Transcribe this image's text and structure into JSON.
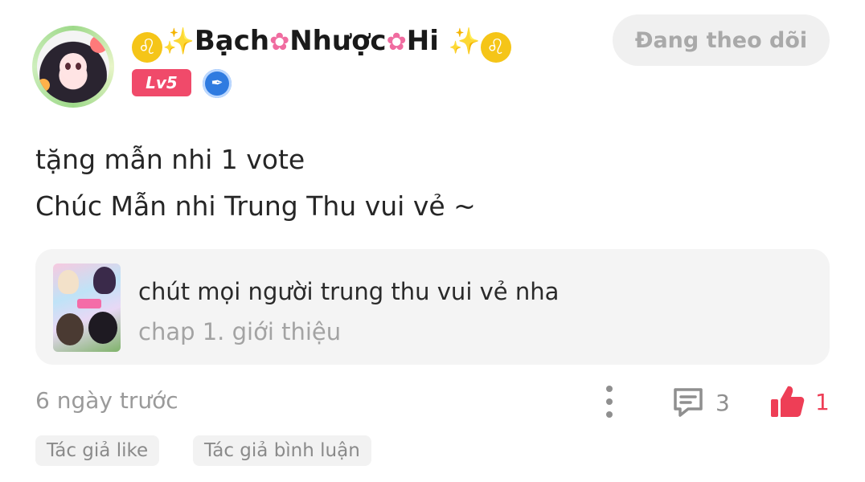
{
  "post": {
    "author": {
      "name_parts": [
        "Bạch",
        "Nhược",
        "Hi"
      ],
      "level": "Lv5",
      "avatar_icon": "anime-girl-avatar",
      "badge_icon": "pen-nib-icon"
    },
    "follow_label": "Đang theo dõi",
    "content_lines": [
      "tặng mẫn nhi 1 vote",
      "Chúc Mẫn nhi Trung Thu vui vẻ ~"
    ],
    "linked_card": {
      "title": "chút mọi người trung thu vui vẻ nha",
      "subtitle": "chap 1. giới thiệu",
      "thumbnail_icon": "comic-cover-thumbnail"
    },
    "timestamp": "6 ngày trước",
    "comment_count": "3",
    "like_count": "1",
    "tags": [
      "Tác giả like",
      "Tác giả bình luận"
    ]
  },
  "colors": {
    "accent_red": "#ee3e56",
    "level_badge": "#f04a6a",
    "muted_text": "#9a9a9a"
  }
}
